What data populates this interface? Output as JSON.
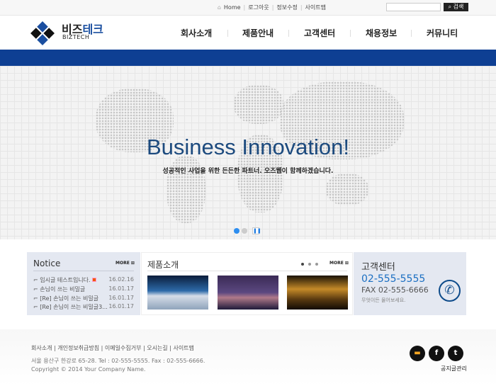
{
  "topbar": {
    "links": [
      "Home",
      "로그아웃",
      "정보수정",
      "사이트맵"
    ],
    "search_placeholder": "",
    "search_button": "검색"
  },
  "logo": {
    "name_a": "비즈",
    "name_b": "테크",
    "name_en": "BIZTECH"
  },
  "nav": [
    "회사소개",
    "제품안내",
    "고객센터",
    "채용정보",
    "커뮤니티"
  ],
  "hero": {
    "title": "Business Innovation!",
    "subtitle": "성공적인 사업을 위한 든든한 파트너. 오즈웹이 함께하겠습니다.",
    "slide_active": 1,
    "slide_count": 2
  },
  "notice": {
    "title": "Notice",
    "more": "MORE",
    "items": [
      {
        "title": "임시글 테스트입니다.",
        "date": "16.02.16",
        "new": true
      },
      {
        "title": "손님이 쓰는 비밀글",
        "date": "16.01.17"
      },
      {
        "title": "[Re] 손님이 쓰는 비밀글",
        "date": "16.01.17"
      },
      {
        "title": "[Re] 손님이 쓰는 비밀글3...",
        "date": "16.01.17"
      }
    ]
  },
  "products": {
    "title": "제품소개",
    "more": "MORE"
  },
  "cs": {
    "title": "고객센터",
    "phone": "02-555-5555",
    "fax": "FAX 02-555-6666",
    "note": "무엇이든 물어보세요."
  },
  "footer": {
    "links": [
      "회사소개",
      "개인정보취급방침",
      "이메일수집거부",
      "오시는길",
      "사이트맵"
    ],
    "address": "서울 용산구 한강로 65-28. Tel : 02-555-5555.  Fax : 02-555-6666.",
    "copyright": "Copyright © 2014 Your Company Name.",
    "admin": "공지글관리"
  },
  "colors": {
    "brand": "#0e3f93",
    "accent": "#1b6fc2"
  }
}
